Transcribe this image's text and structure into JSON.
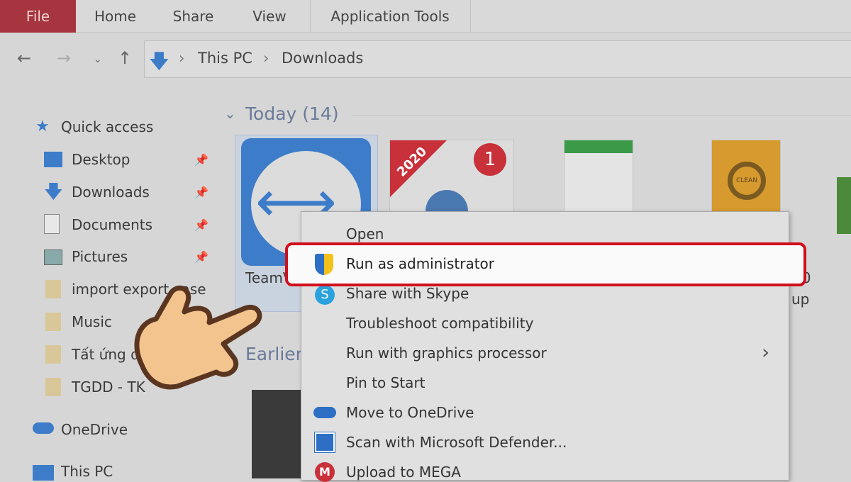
{
  "ribbon": {
    "tabs": [
      "File",
      "Home",
      "Share",
      "View",
      "Application Tools"
    ]
  },
  "address": {
    "crumbs": [
      "This PC",
      "Downloads"
    ]
  },
  "sidebar": {
    "items": [
      {
        "label": "Quick access",
        "icon": "star-icon"
      },
      {
        "label": "Desktop",
        "icon": "desktop-icon",
        "pinned": true
      },
      {
        "label": "Downloads",
        "icon": "download-icon",
        "pinned": true
      },
      {
        "label": "Documents",
        "icon": "document-icon",
        "pinned": true
      },
      {
        "label": "Pictures",
        "icon": "pictures-icon",
        "pinned": true
      },
      {
        "label": "import export case",
        "icon": "folder-icon"
      },
      {
        "label": "Music",
        "icon": "folder-icon"
      },
      {
        "label": "Tất ứng d",
        "icon": "folder-icon"
      },
      {
        "label": "TGDD - TK",
        "icon": "folder-icon"
      },
      {
        "label": "OneDrive",
        "icon": "cloud-icon"
      },
      {
        "label": "This PC",
        "icon": "pc-icon"
      }
    ]
  },
  "content": {
    "group_today": "Today (14)",
    "group_earlier": "Earlier",
    "files": {
      "teamviewer": "TeamVi",
      "partial1": "20",
      "partial2": "up"
    },
    "badge_2020": "2020",
    "badge_count": "1",
    "clean_label": "CLEAN"
  },
  "context_menu": {
    "items": [
      {
        "label": "Open"
      },
      {
        "label": "Run as administrator",
        "icon": "uac-shield-icon",
        "highlighted": true
      },
      {
        "label": "Share with Skype",
        "icon": "skype-icon"
      },
      {
        "label": "Troubleshoot compatibility"
      },
      {
        "label": "Run with graphics processor",
        "submenu": true
      },
      {
        "label": "Pin to Start"
      },
      {
        "label": "Move to OneDrive",
        "icon": "onedrive-icon"
      },
      {
        "label": "Scan with Microsoft Defender...",
        "icon": "defender-icon"
      },
      {
        "label": "Upload to MEGA",
        "icon": "mega-icon"
      }
    ]
  },
  "colors": {
    "file_tab": "#a6353f",
    "highlight_box": "#d0101c",
    "accent": "#3d7cc9"
  }
}
